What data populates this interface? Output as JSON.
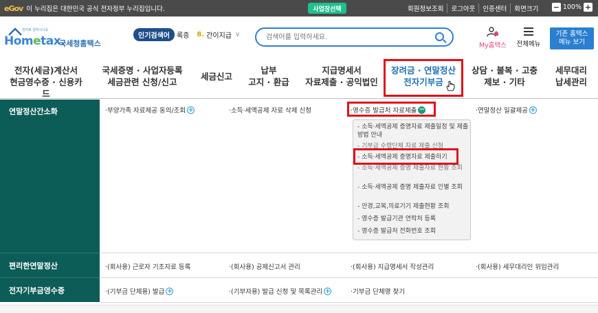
{
  "topbar": {
    "gov_mark": "eGov",
    "notice": "이 누리집은 대한민국 공식 전자정부 누리집입니다.",
    "business_pill": "사업장선택",
    "links": [
      "회원정보조회",
      "로그아웃",
      "인증센터",
      "화면크기"
    ],
    "zoom_minus": "−",
    "zoom_value": "100%",
    "zoom_plus": "+"
  },
  "header": {
    "logo_sub": "전자로 일하시나요",
    "logo_main_pre": "Hom",
    "logo_main_e": "e",
    "logo_main_post": "tax.",
    "logo_kr": "국세청홈택스",
    "popular_badge": "인기검색어",
    "popular_partial": "록증",
    "popular_rank": "8.",
    "popular_term": "간이지급",
    "popular_chevron": "∨",
    "search_placeholder": "검색어를 입력하세요.",
    "myhome_icon": "person-with-house-icon",
    "myhome_label": "My홈택스",
    "allmenu_label": "전체메뉴",
    "oldhome_line1": "기존 홈택스",
    "oldhome_line2": "메뉴 보기"
  },
  "nav": {
    "items": [
      {
        "line1": "전자(세금)계산서",
        "line2": "현금영수증 · 신용카드"
      },
      {
        "line1": "국세증명 · 사업자등록",
        "line2": "세금관련 신청/신고"
      },
      {
        "line1": "세금신고",
        "line2": ""
      },
      {
        "line1": "납부",
        "line2": "고지 · 환급"
      },
      {
        "line1": "지급명세서",
        "line2": "자료제출 · 공익법인"
      },
      {
        "line1": "장려금 · 연말정산",
        "line2": "전자기부금"
      },
      {
        "line1": "상담 · 불복 · 고충",
        "line2": "제보 · 기타"
      },
      {
        "line1": "세무대리",
        "line2": "납세관리"
      }
    ]
  },
  "rows": [
    {
      "head": "연말정산간소화",
      "cells": [
        "·부양가족 자료제공 동의/조회",
        "·소득·세액공제 자료 삭제 신청",
        "·영수증 발급처 자료제출",
        "·연말정산 일괄제공"
      ]
    },
    {
      "head": "편리한연말정산",
      "cells": [
        "·(회사용) 근로자 기초자료 등록",
        "·(회사용) 공제신고서 관리",
        "·(회사용) 지급명세서 작성관리",
        "·(회사용) 세무대리인 위임관리"
      ]
    },
    {
      "head": "전자기부금영수증",
      "cells": [
        "·(기부금 단체용) 발급",
        "·(기부자용) 발급 신청 및 목록관리",
        "·기부금 단체명 찾기"
      ]
    }
  ],
  "dropdown": {
    "items": [
      "- 소득·세액공제 증명자료 제출일정 및 제출방법 안내",
      "- 기부금 수령단체 자료 제출 신청",
      "- 소득·세액공제 증명자료 제출하기",
      "- 소득·세액공제 증명 제출자료 현황 조회",
      "- 소득·세액공제 증명 제출자료 인별 조회",
      "- 안경,교복,의료기기 제출현황 조회",
      "- 영수증 발급기관 연락처 등록",
      "- 영수증 발급처 전화번호 조회"
    ]
  },
  "colors": {
    "sidebar": "#0c5c57",
    "accent": "#2f7fd0",
    "highlight": "#e0101a"
  }
}
